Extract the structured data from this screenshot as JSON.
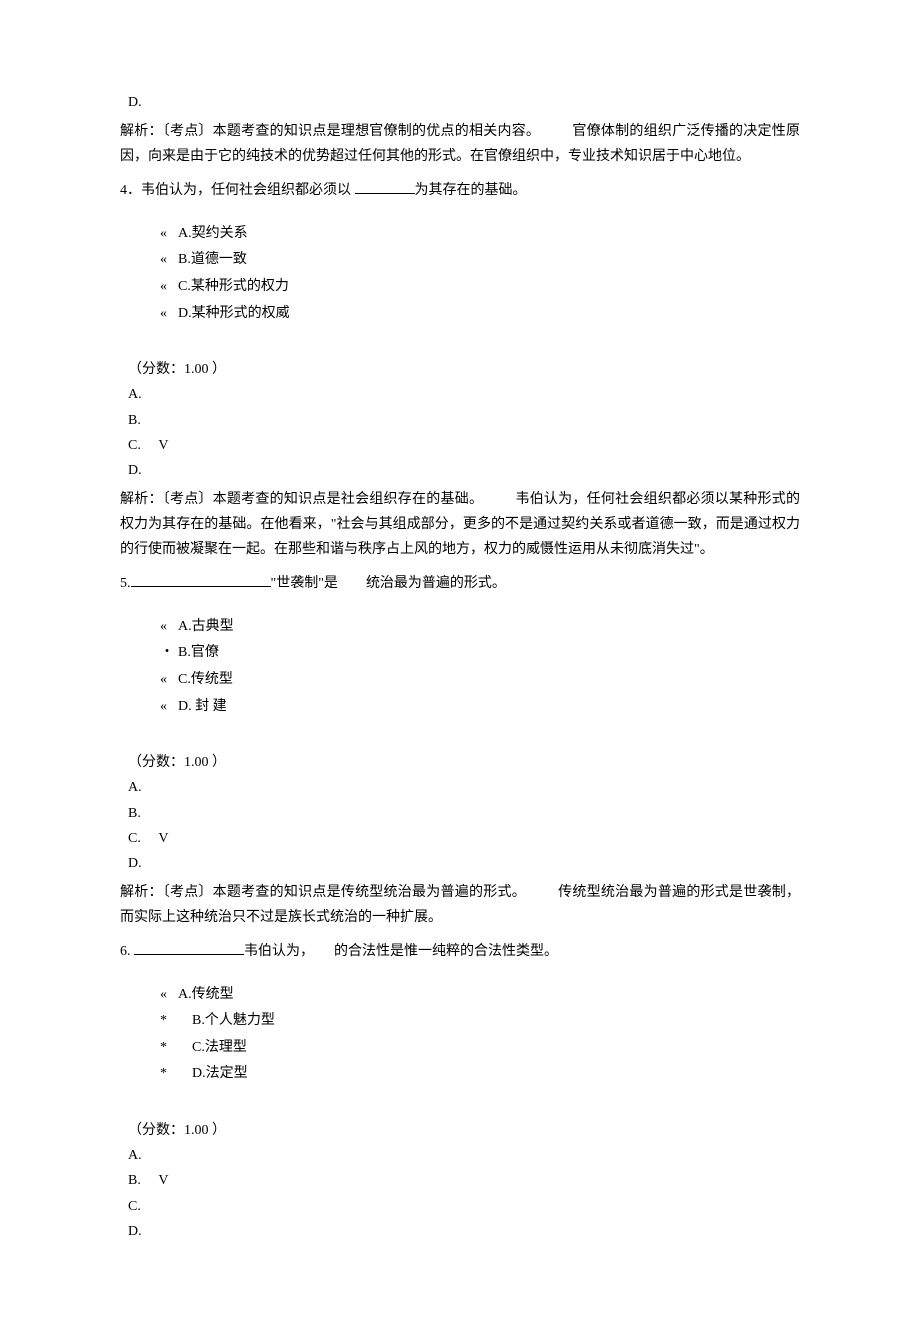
{
  "q3": {
    "answer_d": "D.",
    "explanation_label": "解析：",
    "explanation": "〔考点〕本题考查的知识点是理想官僚制的优点的相关内容。",
    "explanation_gap": "　　　",
    "explanation_tail": "官僚体制的组织广泛传播的决定性原因，向来是由于它的纯技术的优势超过任何其他的形式。在官僚组织中，专业技术知识居于中心地位。"
  },
  "q4": {
    "number": "4．",
    "stem_pre": "韦伯认为，任何社会组织都必须以 ",
    "stem_post": "为其存在的基础。",
    "options": [
      {
        "bullet": "«",
        "label": "A.契约关系"
      },
      {
        "bullet": "«",
        "label": "B.道德一致"
      },
      {
        "bullet": "«",
        "label": "C.某种形式的权力"
      },
      {
        "bullet": "«",
        "label": "D.某种形式的权威"
      }
    ],
    "score": "（分数：1.00 ）",
    "answers": [
      "A.",
      "B.",
      "C. 　V",
      "D."
    ],
    "explanation_label": "解析：",
    "explanation_head": "〔考点〕本题考查的知识点是社会组织存在的基础。",
    "explanation_body": "韦伯认为，任何社会组织都必须以某种形式的权力为其存在的基础。在他看来，\"社会与其组成部分，更多的不是通过契约关系或者道德一致，而是通过权力的行使而被凝聚在一起。在那些和谐与秩序占上风的地方，权力的威慑性运用从未彻底消失过\"。"
  },
  "q5": {
    "number": "5.",
    "stem_mid": "\"世袭制\"是",
    "stem_post": "统治最为普遍的形式。",
    "options": [
      {
        "bullet": "«",
        "label": "A.古典型"
      },
      {
        "bullet": "・",
        "label": "B.官僚"
      },
      {
        "bullet": "«",
        "label": "C.传统型"
      },
      {
        "bullet": "«",
        "label": "D. 封 建"
      }
    ],
    "score": "（分数：1.00 ）",
    "answers": [
      "A.",
      "B.",
      "C. 　V",
      "D."
    ],
    "explanation_label": "解析：",
    "explanation_head": "〔考点〕本题考查的知识点是传统型统治最为普遍的形式。",
    "explanation_body": "传统型统治最为普遍的形式是世袭制，而实际上这种统治只不过是族长式统治的一种扩展。"
  },
  "q6": {
    "number": "6. ",
    "stem_mid": "韦伯认为，",
    "stem_post": "的合法性是惟一纯粹的合法性类型。",
    "options": [
      {
        "bullet": "«",
        "label": "A.传统型"
      },
      {
        "bullet": "*",
        "label": "B.个人魅力型"
      },
      {
        "bullet": "*",
        "label": "C.法理型"
      },
      {
        "bullet": "*",
        "label": "D.法定型"
      }
    ],
    "score": "（分数：1.00 ）",
    "answers": [
      "A.",
      "B. 　V",
      "C.",
      "D."
    ]
  }
}
